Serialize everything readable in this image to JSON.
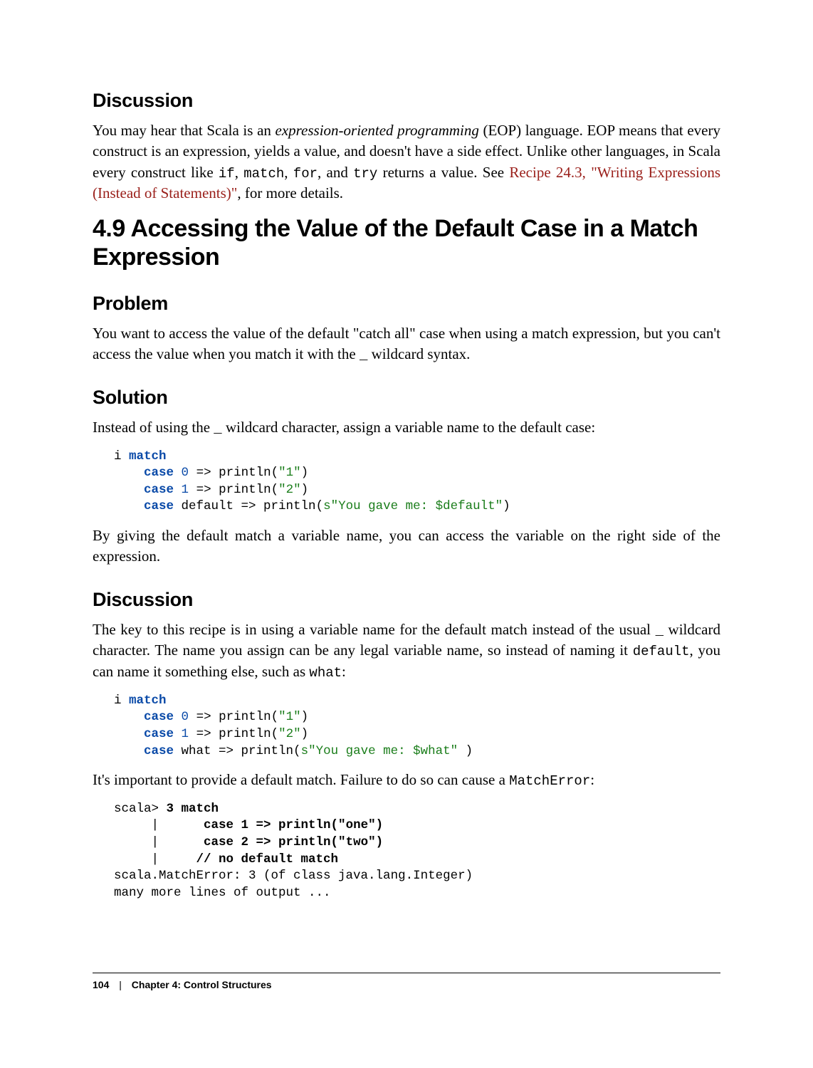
{
  "discussion1": {
    "heading": "Discussion",
    "para_parts": {
      "t1": "You may hear that Scala is an ",
      "em1": "expression-oriented programming",
      "t2": " (EOP) language. EOP means that every construct is an expression, yields a value, and doesn't have a side effect. Unlike other languages, in Scala every construct like ",
      "c1": "if",
      "t3": ", ",
      "c2": "match",
      "t4": ", ",
      "c3": "for",
      "t5": ", and ",
      "c4": "try",
      "t6": " returns a value. See ",
      "link": "Recipe 24.3, \"Writing Expressions (Instead of Statements)\"",
      "t7": ", for more details."
    }
  },
  "section": {
    "title": "4.9 Accessing the Value of the Default Case in a Match Expression"
  },
  "problem": {
    "heading": "Problem",
    "para_parts": {
      "t1": "You want to access the value of the default \"catch all\" case when using a match expression, but you can't access the value when you match it with the ",
      "c1": "_",
      "t2": " wildcard syntax."
    }
  },
  "solution": {
    "heading": "Solution",
    "intro_parts": {
      "t1": "Instead of using the ",
      "c1": "_",
      "t2": " wildcard character, assign a variable name to the default case:"
    },
    "code1": {
      "l1_a": "i ",
      "l1_b": "match",
      "l2_a": "    ",
      "l2_b": "case",
      "l2_c": " ",
      "l2_d": "0",
      "l2_e": " => println(",
      "l2_f": "\"1\"",
      "l2_g": ")",
      "l3_a": "    ",
      "l3_b": "case",
      "l3_c": " ",
      "l3_d": "1",
      "l3_e": " => println(",
      "l3_f": "\"2\"",
      "l3_g": ")",
      "l4_a": "    ",
      "l4_b": "case",
      "l4_c": " default => println(",
      "l4_d": "s\"You gave me: $default\"",
      "l4_e": ")"
    },
    "after": "By giving the default match a variable name, you can access the variable on the right side of the expression."
  },
  "discussion2": {
    "heading": "Discussion",
    "para1_parts": {
      "t1": "The key to this recipe is in using a variable name for the default match instead of the usual ",
      "c1": "_",
      "t2": " wildcard character. The name you assign can be any legal variable name, so instead of naming it ",
      "c2": "default",
      "t3": ", you can name it something else, such as ",
      "c3": "what",
      "t4": ":"
    },
    "code2": {
      "l1_a": "i ",
      "l1_b": "match",
      "l2_a": "    ",
      "l2_b": "case",
      "l2_c": " ",
      "l2_d": "0",
      "l2_e": " => println(",
      "l2_f": "\"1\"",
      "l2_g": ")",
      "l3_a": "    ",
      "l3_b": "case",
      "l3_c": " ",
      "l3_d": "1",
      "l3_e": " => println(",
      "l3_f": "\"2\"",
      "l3_g": ")",
      "l4_a": "    ",
      "l4_b": "case",
      "l4_c": " what => println(",
      "l4_d": "s\"You gave me: $what\"",
      "l4_e": " )"
    },
    "para2_parts": {
      "t1": "It's important to provide a default match. Failure to do so can cause a ",
      "c1": "MatchError",
      "t2": ":"
    },
    "code3": {
      "l1_a": "scala> ",
      "l1_b": "3 match",
      "l2_a": "     |      ",
      "l2_b": "case 1 => println(\"one\")",
      "l3_a": "     |      ",
      "l3_b": "case 2 => println(\"two\")",
      "l4_a": "     |     ",
      "l4_b": "// no default match",
      "l5": "scala.MatchError: 3 (of class java.lang.Integer)",
      "l6": "many more lines of output ..."
    }
  },
  "footer": {
    "pagenum": "104",
    "sep": "|",
    "chapter": "Chapter 4: Control Structures"
  }
}
